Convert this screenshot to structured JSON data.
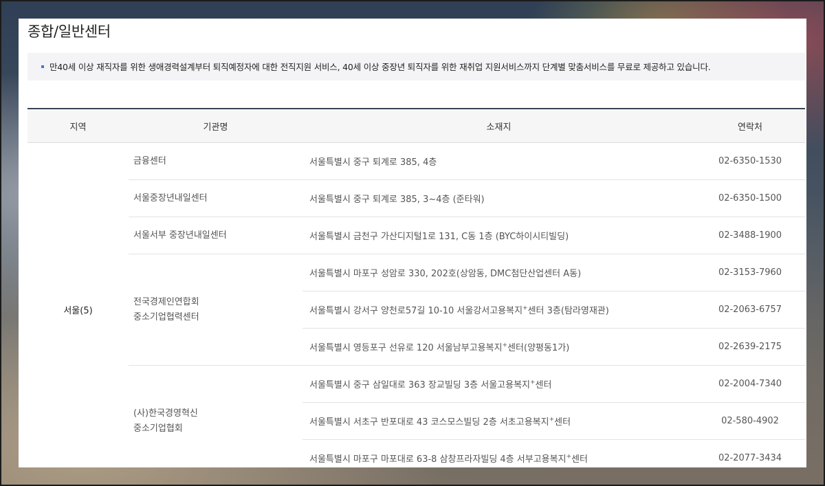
{
  "page": {
    "title": "종합/일반센터",
    "notice": "만40세 이상 재직자를 위한 생애경력설계부터 퇴직예정자에 대한 전직지원 서비스, 40세 이상 중장년 퇴직자를 위한 재취업 지원서비스까지 단계별 맞춤서비스를 무료로 제공하고 있습니다."
  },
  "table": {
    "headers": {
      "region": "지역",
      "org": "기관명",
      "address": "소재지",
      "contact": "연락처"
    },
    "region": "서울(5)",
    "rows": [
      {
        "org": "금융센터",
        "address": "서울특별시 중구 퇴계로 385, 4층",
        "phone": "02-6350-1530"
      },
      {
        "org": "서울중장년내일센터",
        "address": "서울특별시 중구 퇴계로 385, 3~4층 (준타워)",
        "phone": "02-6350-1500"
      },
      {
        "org": "서울서부 중장년내일센터",
        "address": "서울특별시 금천구 가산디지털1로 131, C동 1층 (BYC하이시티빌딩)",
        "phone": "02-3488-1900"
      },
      {
        "org_line1": "전국경제인연합회",
        "org_line2": "중소기업협력센터",
        "sub": [
          {
            "address": "서울특별시 마포구 성암로 330, 202호(상암동, DMC첨단산업센터 A동)",
            "phone": "02-3153-7960"
          },
          {
            "address_a": "서울특별시 강서구 양천로57길 10-10 서울강서고용복지",
            "address_sup": "+",
            "address_b": "센터 3층(탐라영재관)",
            "phone": "02-2063-6757"
          },
          {
            "address_a": "서울특별시 영등포구 선유로 120 서울남부고용복지",
            "address_sup": "+",
            "address_b": "센터(양평동1가)",
            "phone": "02-2639-2175"
          }
        ]
      },
      {
        "org_line1": "(사)한국경영혁신",
        "org_line2": "중소기업협회",
        "sub": [
          {
            "address_a": "서울특별시 중구 삼일대로 363 장교빌딩 3층 서울고용복지",
            "address_sup": "+",
            "address_b": "센터",
            "phone": "02-2004-7340"
          },
          {
            "address_a": "서울특별시 서초구 반포대로 43 코스모스빌딩 2층 서초고용복지",
            "address_sup": "+",
            "address_b": "센터",
            "phone": "02-580-4902"
          },
          {
            "address_a": "서울특별시 마포구 마포대로 63-8 삼창프라자빌딩 4층 서부고용복지",
            "address_sup": "+",
            "address_b": "센터",
            "phone": "02-2077-3434"
          }
        ]
      }
    ]
  }
}
